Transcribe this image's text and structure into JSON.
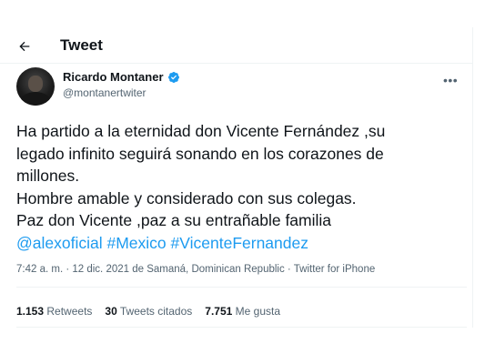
{
  "header": {
    "title": "Tweet",
    "back_icon": "arrow-left-icon"
  },
  "author": {
    "name": "Ricardo Montaner",
    "handle": "@montanertwiter",
    "verified": true,
    "verified_color": "#1d9bf0"
  },
  "more_icon": "•••",
  "tweet": {
    "lines": [
      "Ha partido a la eternidad don Vicente Fernández ,su",
      "legado infinito seguirá sonando en los corazones de",
      "millones.",
      "Hombre amable y considerado con sus colegas.",
      "Paz don Vicente ,paz a su entrañable familia"
    ],
    "tags": [
      "@alexoficial",
      "#Mexico",
      "#VicenteFernandez"
    ],
    "link_color": "#1d9bf0"
  },
  "meta": {
    "time": "7:42 a. m.",
    "sep1": " · ",
    "date": "12 dic. 2021",
    "location": " de Samaná, Dominican Republic",
    "sep2": " · ",
    "source": "Twitter for iPhone"
  },
  "stats": {
    "retweets_count": "1.153",
    "retweets_label": "Retweets",
    "quotes_count": "30",
    "quotes_label": "Tweets citados",
    "likes_count": "7.751",
    "likes_label": "Me gusta"
  }
}
